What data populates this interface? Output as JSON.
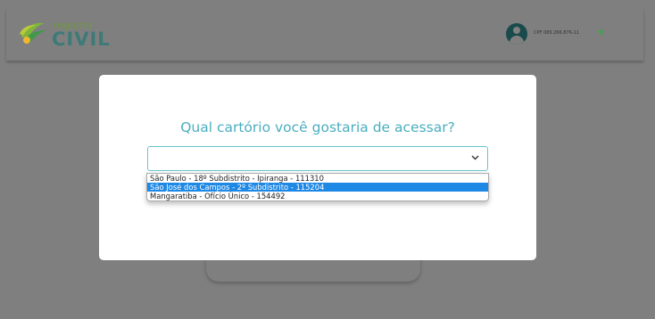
{
  "header": {
    "logo": {
      "line1": "registro",
      "line2": "CIVIL"
    },
    "user": {
      "cpf_label": "CPF 089.266.876-11",
      "avatar_icon": "user-avatar-icon",
      "menu_icon": "caret-down-icon"
    }
  },
  "modal": {
    "title": "Qual cartório você gostaria de acessar?",
    "select": {
      "value": "",
      "options": [
        "São Paulo - 18º Subdistrito - Ipiranga - 111310",
        "São José dos Campos - 2º Subdistrito - 115204",
        "Mangaratiba - Ofício Único - 154492"
      ],
      "highlighted_index": 1
    }
  },
  "colors": {
    "title": "#4aaec0",
    "highlight": "#1e88e5",
    "select_border": "#66c6cf",
    "backdrop": "#7f7f7f"
  }
}
